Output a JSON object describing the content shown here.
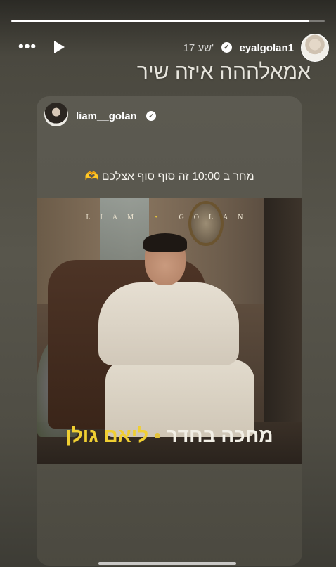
{
  "story": {
    "progress_fraction": 0.95
  },
  "header": {
    "username": "eyalgolan1",
    "time": "17 שע'",
    "play_icon": "play-icon",
    "more_icon": "more-icon",
    "more_label": "•••",
    "verified_glyph": "✓"
  },
  "caption": "אמאלההה איזה שיר",
  "shared_post": {
    "username": "liam__golan",
    "verified_glyph": "✓",
    "text": "מחר ב 10:00 זה סוף סוף אצלכם 🫶",
    "cover": {
      "brand_left": "LIAM",
      "brand_dot": "•",
      "brand_right": "GOLAN",
      "title_main": "מחכה בחדר",
      "title_sep": "•",
      "title_artist": "ליאם גולן"
    }
  },
  "colors": {
    "accent_yellow": "#f0cf32",
    "background": "#58564c"
  }
}
